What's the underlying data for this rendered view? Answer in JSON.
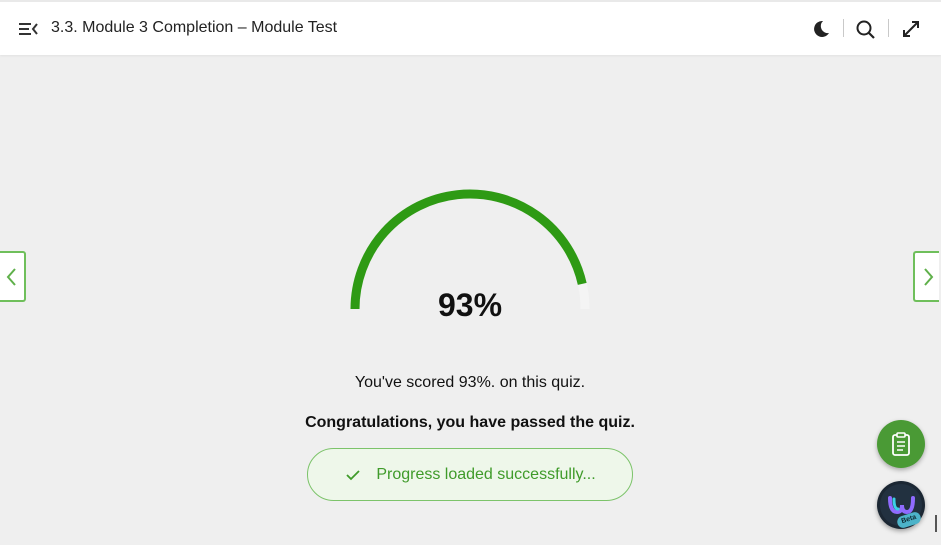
{
  "header": {
    "title": "3.3. Module 3 Completion – Module Test",
    "icons": [
      "menu-collapse-icon",
      "moon-icon",
      "search-icon",
      "expand-icon"
    ]
  },
  "result": {
    "percent": 93,
    "percent_label": "93%",
    "score_text": "You've scored 93%. on this quiz.",
    "status_text": "Congratulations, you have passed the quiz."
  },
  "toast": {
    "message": "Progress loaded successfully..."
  },
  "widgets": {
    "beta_label": "Beta"
  },
  "colors": {
    "accent": "#2e9a14",
    "toast_text": "#3f9b2a",
    "toast_border": "#7cc36a",
    "fab": "#4a9a35",
    "nav_border": "#6fbf5b"
  }
}
